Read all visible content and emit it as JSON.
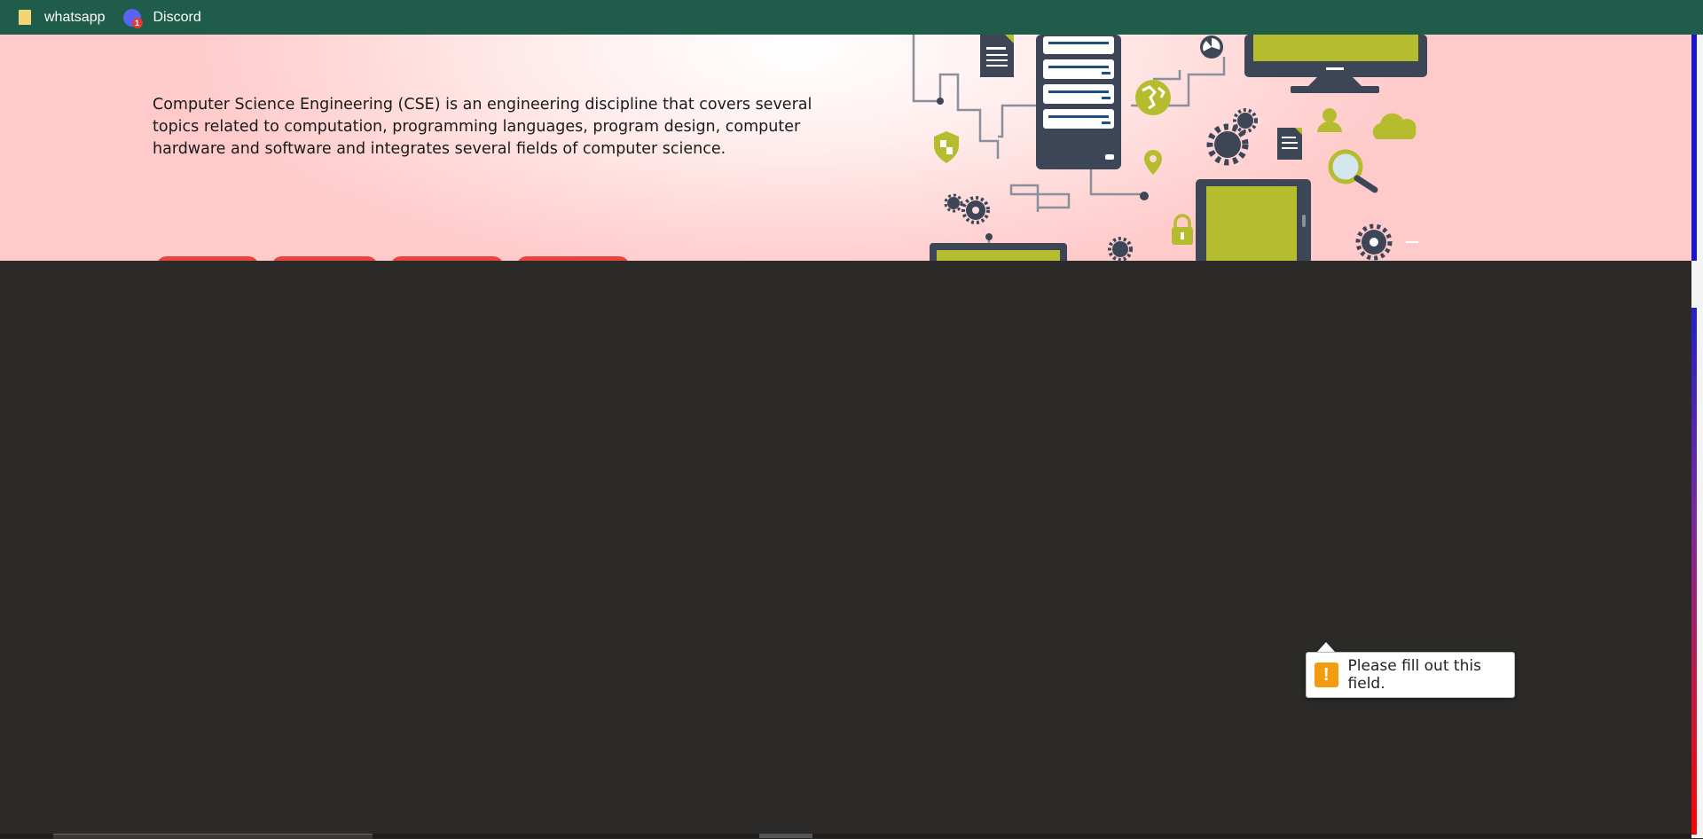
{
  "bookmarks": [
    {
      "label": "whatsapp",
      "icon": "folder-icon"
    },
    {
      "label": "Discord",
      "icon": "discord-icon",
      "badge": "1"
    }
  ],
  "hero": {
    "description": "Computer Science Engineering (CSE) is an engineering discipline that covers several topics related to computation, programming languages, program design, computer hardware and software and integrates several fields of computer science."
  },
  "validation_tooltip": {
    "icon": "warning-icon",
    "symbol": "!",
    "message": "Please fill out this field."
  },
  "colors": {
    "bookmarks_bar": "#1f5c4a",
    "hero_background": "#ffd8d8",
    "pill_buttons": "#e9443b",
    "illustration_dark": "#3d4657",
    "illustration_accent": "#b5bd2e",
    "page_background": "#2b2a28",
    "warning": "#f39c12"
  }
}
